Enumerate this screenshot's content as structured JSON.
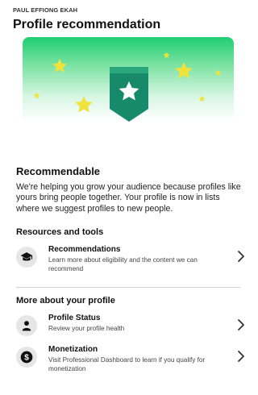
{
  "header": {
    "account_name": "PAUL EFFIONG EKAH",
    "title": "Profile recommendation"
  },
  "hero": {
    "icons": [
      "star-icon",
      "badge-star-icon"
    ],
    "colors": {
      "gradient_top": "#1fce73",
      "star": "#f3e23a",
      "badge": "#1a8f6a"
    }
  },
  "status": {
    "title": "Recommendable",
    "description": "We're helping you grow your audience because profiles like yours bring people together. Your profile is now in lists where we suggest profiles to new people."
  },
  "resources": {
    "title": "Resources and tools",
    "items": [
      {
        "title": "Recommendations",
        "subtitle": "Learn more about eligibility and the content we can recommend",
        "icon": "graduation-cap-icon"
      }
    ]
  },
  "more": {
    "title": "More about your profile",
    "items": [
      {
        "title": "Profile Status",
        "subtitle": "Review your profile health",
        "icon": "person-icon"
      },
      {
        "title": "Monetization",
        "subtitle": "Visit Professional Dashboard to learn if you qualify for monetization",
        "icon": "dollar-icon"
      }
    ]
  }
}
